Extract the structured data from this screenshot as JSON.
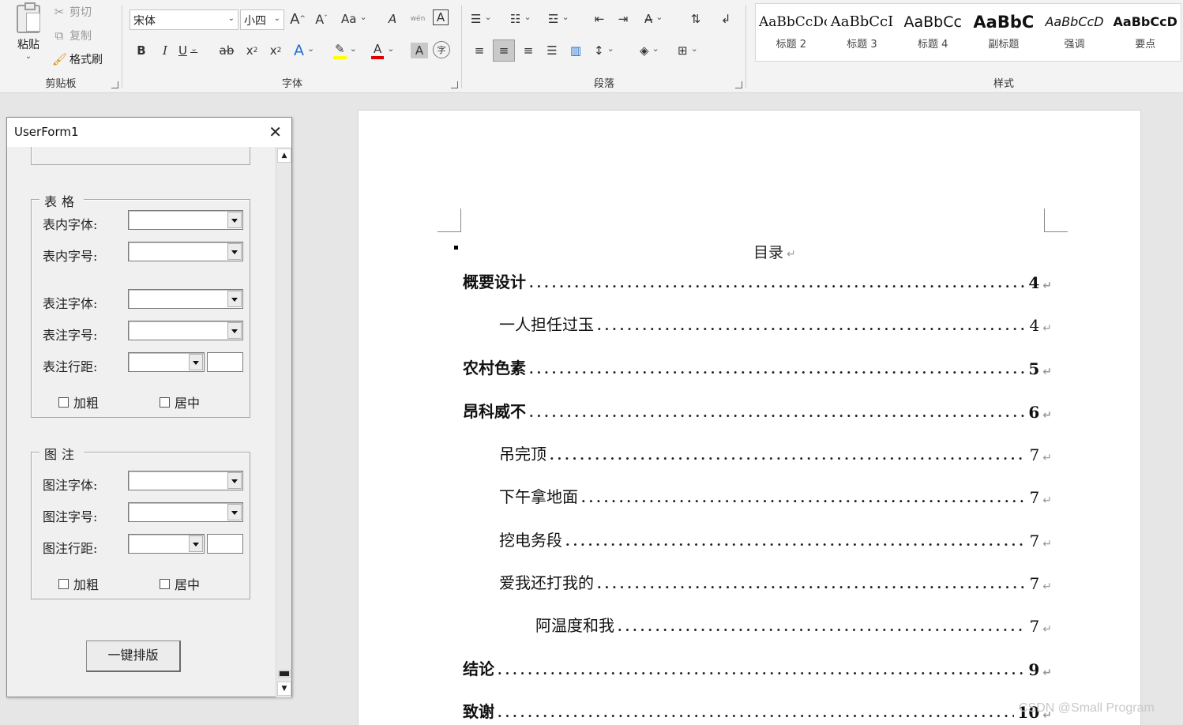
{
  "ribbon": {
    "clipboard": {
      "paste_label": "粘贴",
      "cut_label": "剪切",
      "copy_label": "复制",
      "format_painter_label": "格式刷",
      "group_label": "剪贴板"
    },
    "font": {
      "font_name": "宋体",
      "font_size": "小四",
      "grow_label": "A",
      "shrink_label": "A",
      "case_label": "Aa",
      "clear_label": "A",
      "phonetic_label": "wén",
      "border_char_label": "A",
      "bold_label": "B",
      "italic_label": "I",
      "underline_label": "U",
      "strike_label": "ab",
      "subscript_label": "x",
      "superscript_label": "x",
      "effect_label": "A",
      "highlight_label": "✎",
      "font_color_label": "A",
      "shade_label": "A",
      "enclose_label": "字",
      "group_label": "字体",
      "highlight_color": "#ffff00",
      "font_color": "#e00000"
    },
    "paragraph": {
      "group_label": "段落"
    },
    "styles": {
      "group_label": "样式",
      "items": [
        {
          "sample": "AaBbCcDc",
          "name": "标题 2"
        },
        {
          "sample": "AaBbCcI",
          "name": "标题 3"
        },
        {
          "sample": "AaBbCc",
          "name": "标题 4"
        },
        {
          "sample": "AaBbC",
          "name": "副标题"
        },
        {
          "sample": "AaBbCcD",
          "name": "强调"
        },
        {
          "sample": "AaBbCcD",
          "name": "要点"
        }
      ]
    }
  },
  "userform": {
    "title": "UserForm1",
    "table_frame": {
      "caption": "表格",
      "font_label": "表内字体:",
      "size_label": "表内字号:",
      "note_font_label": "表注字体:",
      "note_size_label": "表注字号:",
      "note_spacing_label": "表注行距:",
      "bold_label": "加粗",
      "center_label": "居中"
    },
    "figure_frame": {
      "caption": "图注",
      "font_label": "图注字体:",
      "size_label": "图注字号:",
      "spacing_label": "图注行距:",
      "bold_label": "加粗",
      "center_label": "居中"
    },
    "apply_button": "一键排版"
  },
  "document": {
    "toc_title": "目录",
    "paragraph_mark": "↵",
    "entries": [
      {
        "text": "概要设计",
        "page": "4",
        "level": 1
      },
      {
        "text": "一人担任过玉",
        "page": "4",
        "level": 2
      },
      {
        "text": "农村色素",
        "page": "5",
        "level": 1
      },
      {
        "text": "昂科威不",
        "page": "6",
        "level": 1
      },
      {
        "text": "吊完顶",
        "page": "7",
        "level": 2
      },
      {
        "text": "下午拿地面",
        "page": "7",
        "level": 2
      },
      {
        "text": "挖电务段",
        "page": "7",
        "level": 2
      },
      {
        "text": "爱我还打我的",
        "page": "7",
        "level": 2
      },
      {
        "text": "阿温度和我",
        "page": "7",
        "level": 3
      },
      {
        "text": "结论",
        "page": "9",
        "level": 1
      },
      {
        "text": "致谢",
        "page": "10",
        "level": 1
      }
    ]
  },
  "watermark": "CSDN @Small Program"
}
